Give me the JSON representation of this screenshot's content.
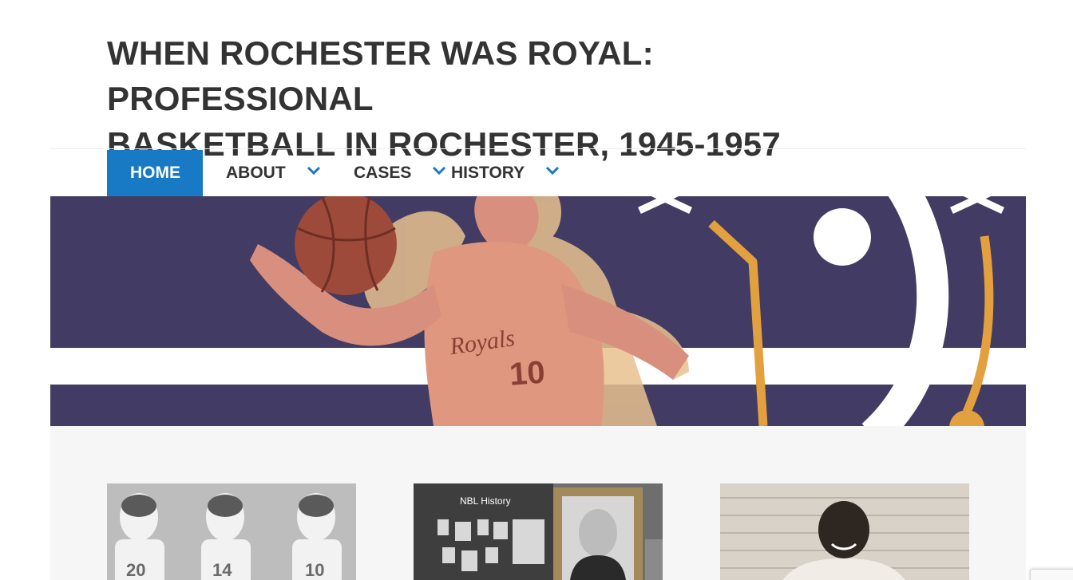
{
  "site": {
    "title_line1": "WHEN ROCHESTER WAS ROYAL: PROFESSIONAL",
    "title_line2": "BASKETBALL IN ROCHESTER, 1945-1957"
  },
  "nav": {
    "items": [
      {
        "label": "HOME",
        "active": true
      },
      {
        "label": "ABOUT",
        "has_dropdown": true
      },
      {
        "label": "CASES",
        "has_dropdown": true
      },
      {
        "label": "HISTORY",
        "has_dropdown": true
      }
    ]
  },
  "hero": {
    "jersey_text": "Royals",
    "jersey_number": "10"
  },
  "cards": [
    {
      "name": "team-photo"
    },
    {
      "name": "nbl-history-exhibit",
      "sign_text": "NBL History"
    },
    {
      "name": "player-portrait"
    }
  ],
  "colors": {
    "nav_active": "#1879c4",
    "hero_background": "#423b63",
    "hero_accent": "#e3a03f",
    "content_band": "#f6f6f6",
    "title_text": "#333333"
  }
}
